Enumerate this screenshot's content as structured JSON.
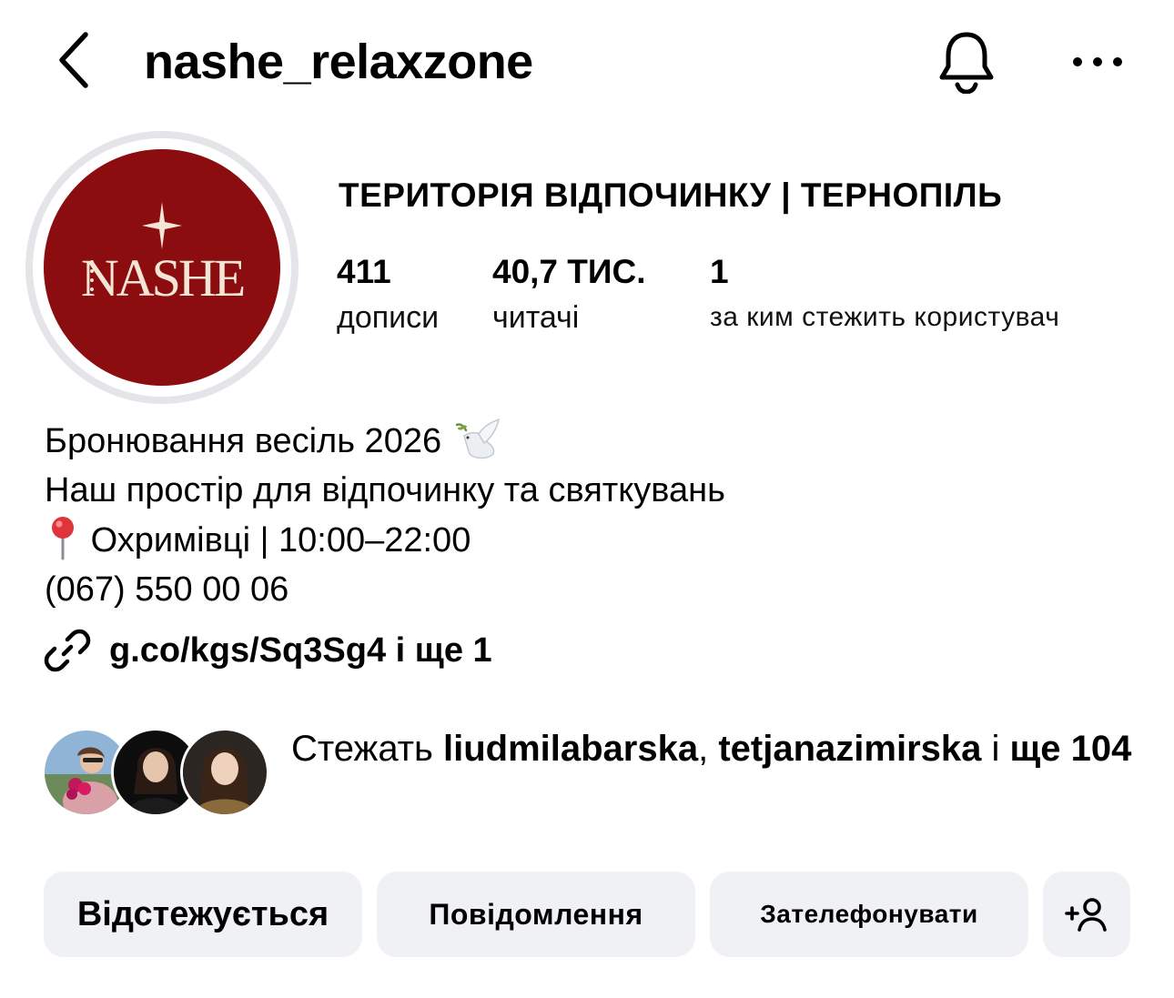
{
  "header": {
    "back_icon": "chevron-left-icon",
    "username": "nashe_relaxzone",
    "bell_icon": "bell-icon",
    "more_icon": "more-horizontal-icon"
  },
  "profile": {
    "avatar_logo_text": "NASHE",
    "full_name": "ТЕРИТОРІЯ ВІДПОЧИНКУ | ТЕРНОПІЛЬ",
    "stats": {
      "posts": {
        "value": "411",
        "label": "дописи"
      },
      "followers": {
        "value": "40,7 ТИС.",
        "label": "читачі"
      },
      "following": {
        "value": "1",
        "label": "за ким стежить користувач"
      }
    }
  },
  "bio": {
    "line1": "Бронювання весіль 2026",
    "line2": "Наш простір для відпочинку та святкувань",
    "line3": "Охримівці | 10:00–22:00",
    "line4": "(067) 550 00 06"
  },
  "link": {
    "icon": "link-icon",
    "text": "g.co/kgs/Sq3Sg4 і ще 1"
  },
  "followed_by": {
    "prefix": "Стежать",
    "user1": "liudmilabarska",
    "separator": ",",
    "user2": "tetjanazimirska",
    "middle": "і",
    "more": "ще 104"
  },
  "actions": {
    "following_label": "Відстежується",
    "message_label": "Повідомлення",
    "call_label": "Зателефонувати",
    "add_icon": "add-person-icon"
  },
  "colors": {
    "brand_red": "#8b0d10",
    "button_bg": "#eff1f4",
    "ring": "#e3e5e8"
  }
}
